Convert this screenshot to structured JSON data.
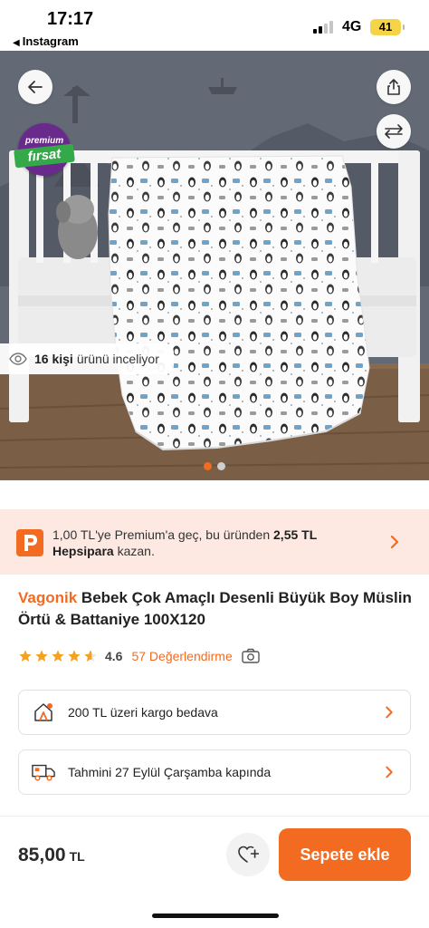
{
  "status_bar": {
    "time": "17:17",
    "back_app": "Instagram",
    "network": "4G",
    "battery": "41"
  },
  "hero": {
    "badge_top": "premium",
    "badge_bottom": "fırsat",
    "viewers_count": "16 kişi",
    "viewers_text": "ürünü inceliyor",
    "image_count": 2,
    "active_image": 0
  },
  "premium_banner": {
    "line1_prefix": "1,00 TL'ye Premium'a geç, bu üründen",
    "amount": "2,55 TL",
    "brand": "Hepsipara",
    "suffix": "kazan."
  },
  "product": {
    "brand": "Vagonik",
    "title": "Bebek Çok Amaçlı Desenli Büyük Boy Müslin Örtü & Battaniye 100X120",
    "rating": "4.6",
    "review_count": "57 Değerlendirme",
    "stars_filled": 4.6
  },
  "info_cards": {
    "shipping": "200 TL üzeri kargo bedava",
    "delivery": "Tahmini 27 Eylül Çarşamba kapında"
  },
  "bottom_bar": {
    "price": "85,00",
    "currency": "TL",
    "cart_label": "Sepete ekle"
  },
  "colors": {
    "accent": "#f36b21",
    "premium_bg": "#fde9e1",
    "badge_purple": "#6a2a8c",
    "badge_green": "#35a84a"
  },
  "icons": {
    "back": "arrow-left-icon",
    "share": "share-icon",
    "compare": "compare-arrows-icon",
    "eye": "eye-icon",
    "premium": "premium-p-icon",
    "chevron": "chevron-right-icon",
    "shipping": "cargo-icon",
    "delivery": "truck-icon",
    "camera": "camera-icon",
    "favorite": "heart-plus-icon"
  }
}
